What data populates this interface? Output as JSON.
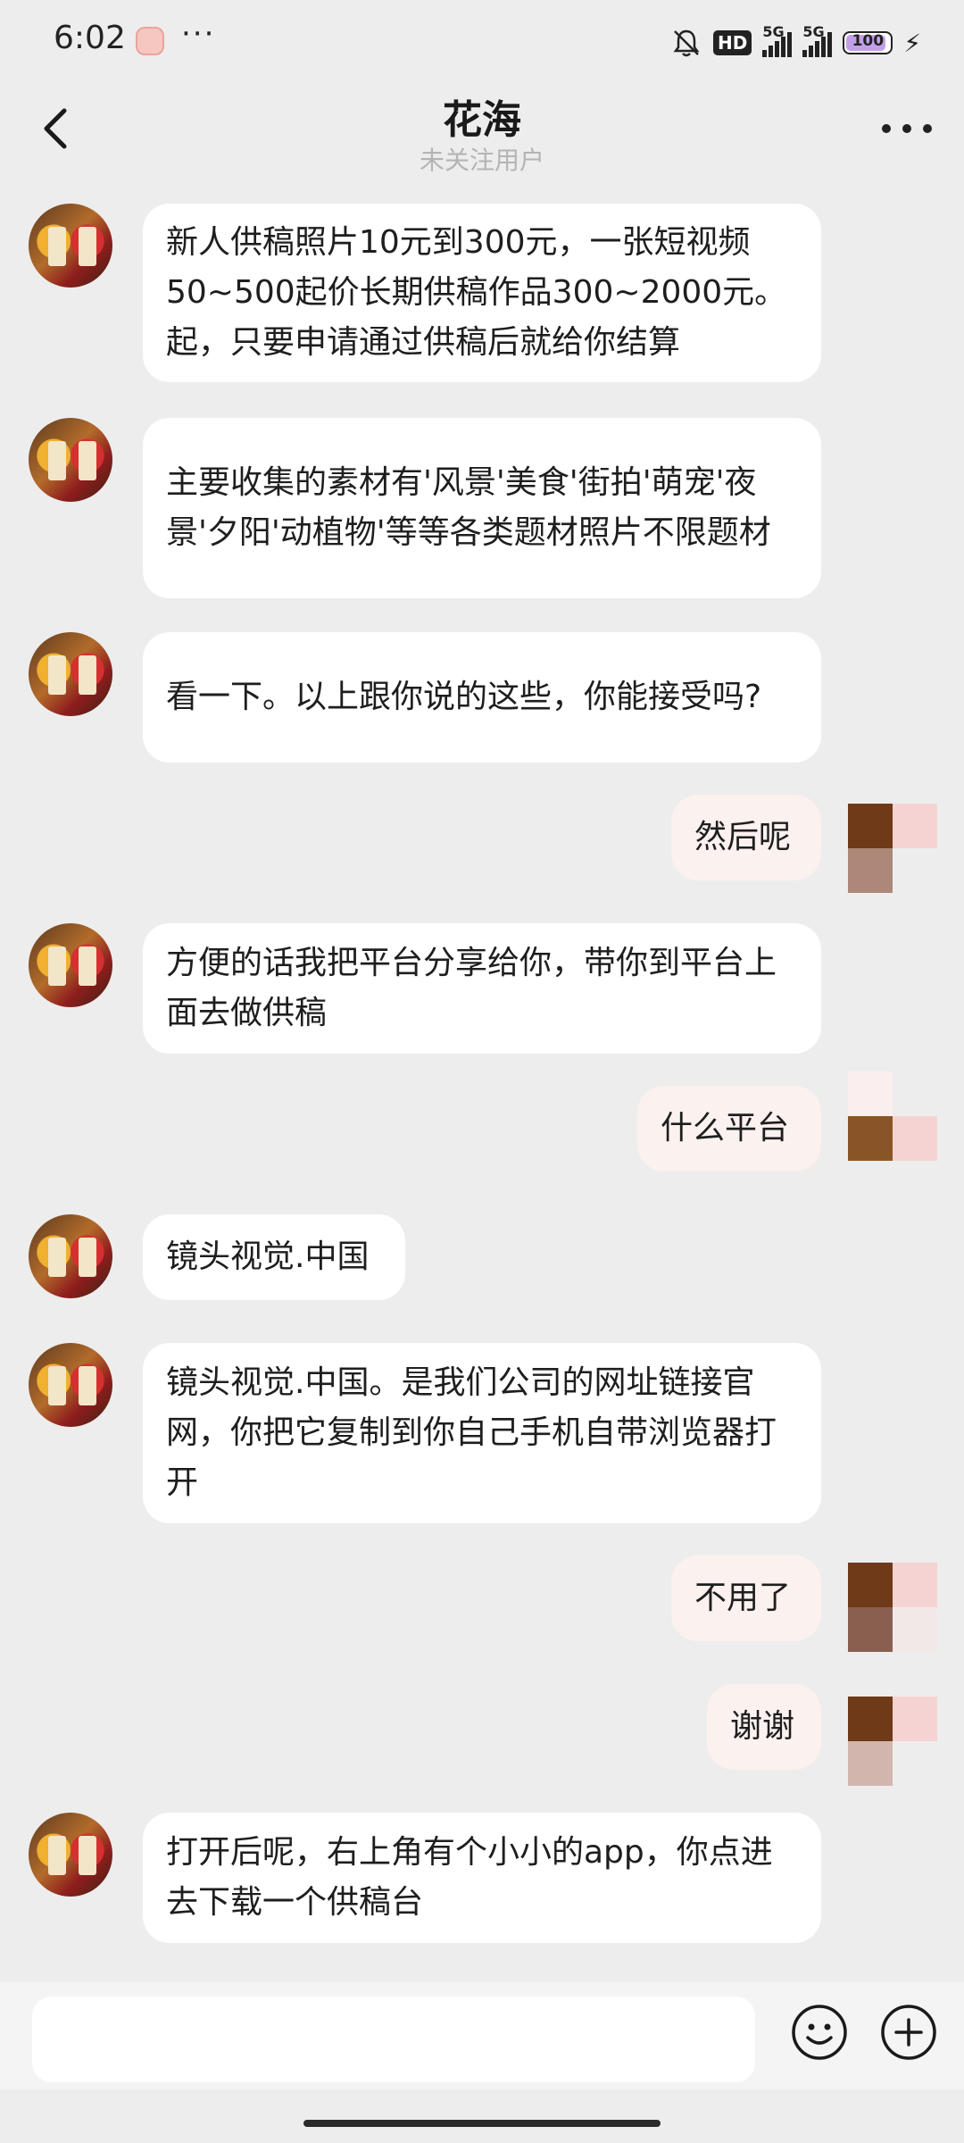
{
  "status_bar": {
    "time": "6:02",
    "more": "···",
    "hd_label": "HD",
    "signal1_label": "5G",
    "signal2_label": "5G",
    "battery": "100",
    "charge_icon": "⚡"
  },
  "header": {
    "title": "花海",
    "subtitle": "未关注用户"
  },
  "messages": [
    {
      "direction": "in",
      "text": "新人供稿照片10元到300元，一张短视频50~500起价长期供稿作品300~2000元。起，只要申请通过供稿后就给你结算"
    },
    {
      "direction": "in",
      "text": "主要收集的素材有'风景'美食'街拍'萌宠'夜景'夕阳'动植物'等等各类题材照片不限题材"
    },
    {
      "direction": "in",
      "text": "看一下。以上跟你说的这些，你能接受吗?"
    },
    {
      "direction": "out",
      "text": "然后呢"
    },
    {
      "direction": "in",
      "text": "方便的话我把平台分享给你，带你到平台上面去做供稿"
    },
    {
      "direction": "out",
      "text": "什么平台"
    },
    {
      "direction": "in",
      "text": "镜头视觉.中国"
    },
    {
      "direction": "in",
      "text": "镜头视觉.中国。是我们公司的网址链接官网，你把它复制到你自己手机自带浏览器打开"
    },
    {
      "direction": "out",
      "text": "不用了"
    },
    {
      "direction": "out",
      "text": "谢谢"
    },
    {
      "direction": "in",
      "text": "打开后呢，右上角有个小小的app，你点进去下载一个供稿台"
    }
  ],
  "input": {
    "value": "",
    "placeholder": ""
  },
  "colors": {
    "background": "#ededed",
    "bubble_in": "#ffffff",
    "bubble_out": "#fbf1ef",
    "subtitle": "#b4b4b4"
  },
  "icons": {
    "back": "back-arrow-icon",
    "more": "more-dots-icon",
    "emoji": "emoji-icon",
    "plus": "plus-icon",
    "bell": "bell-muted-icon"
  }
}
